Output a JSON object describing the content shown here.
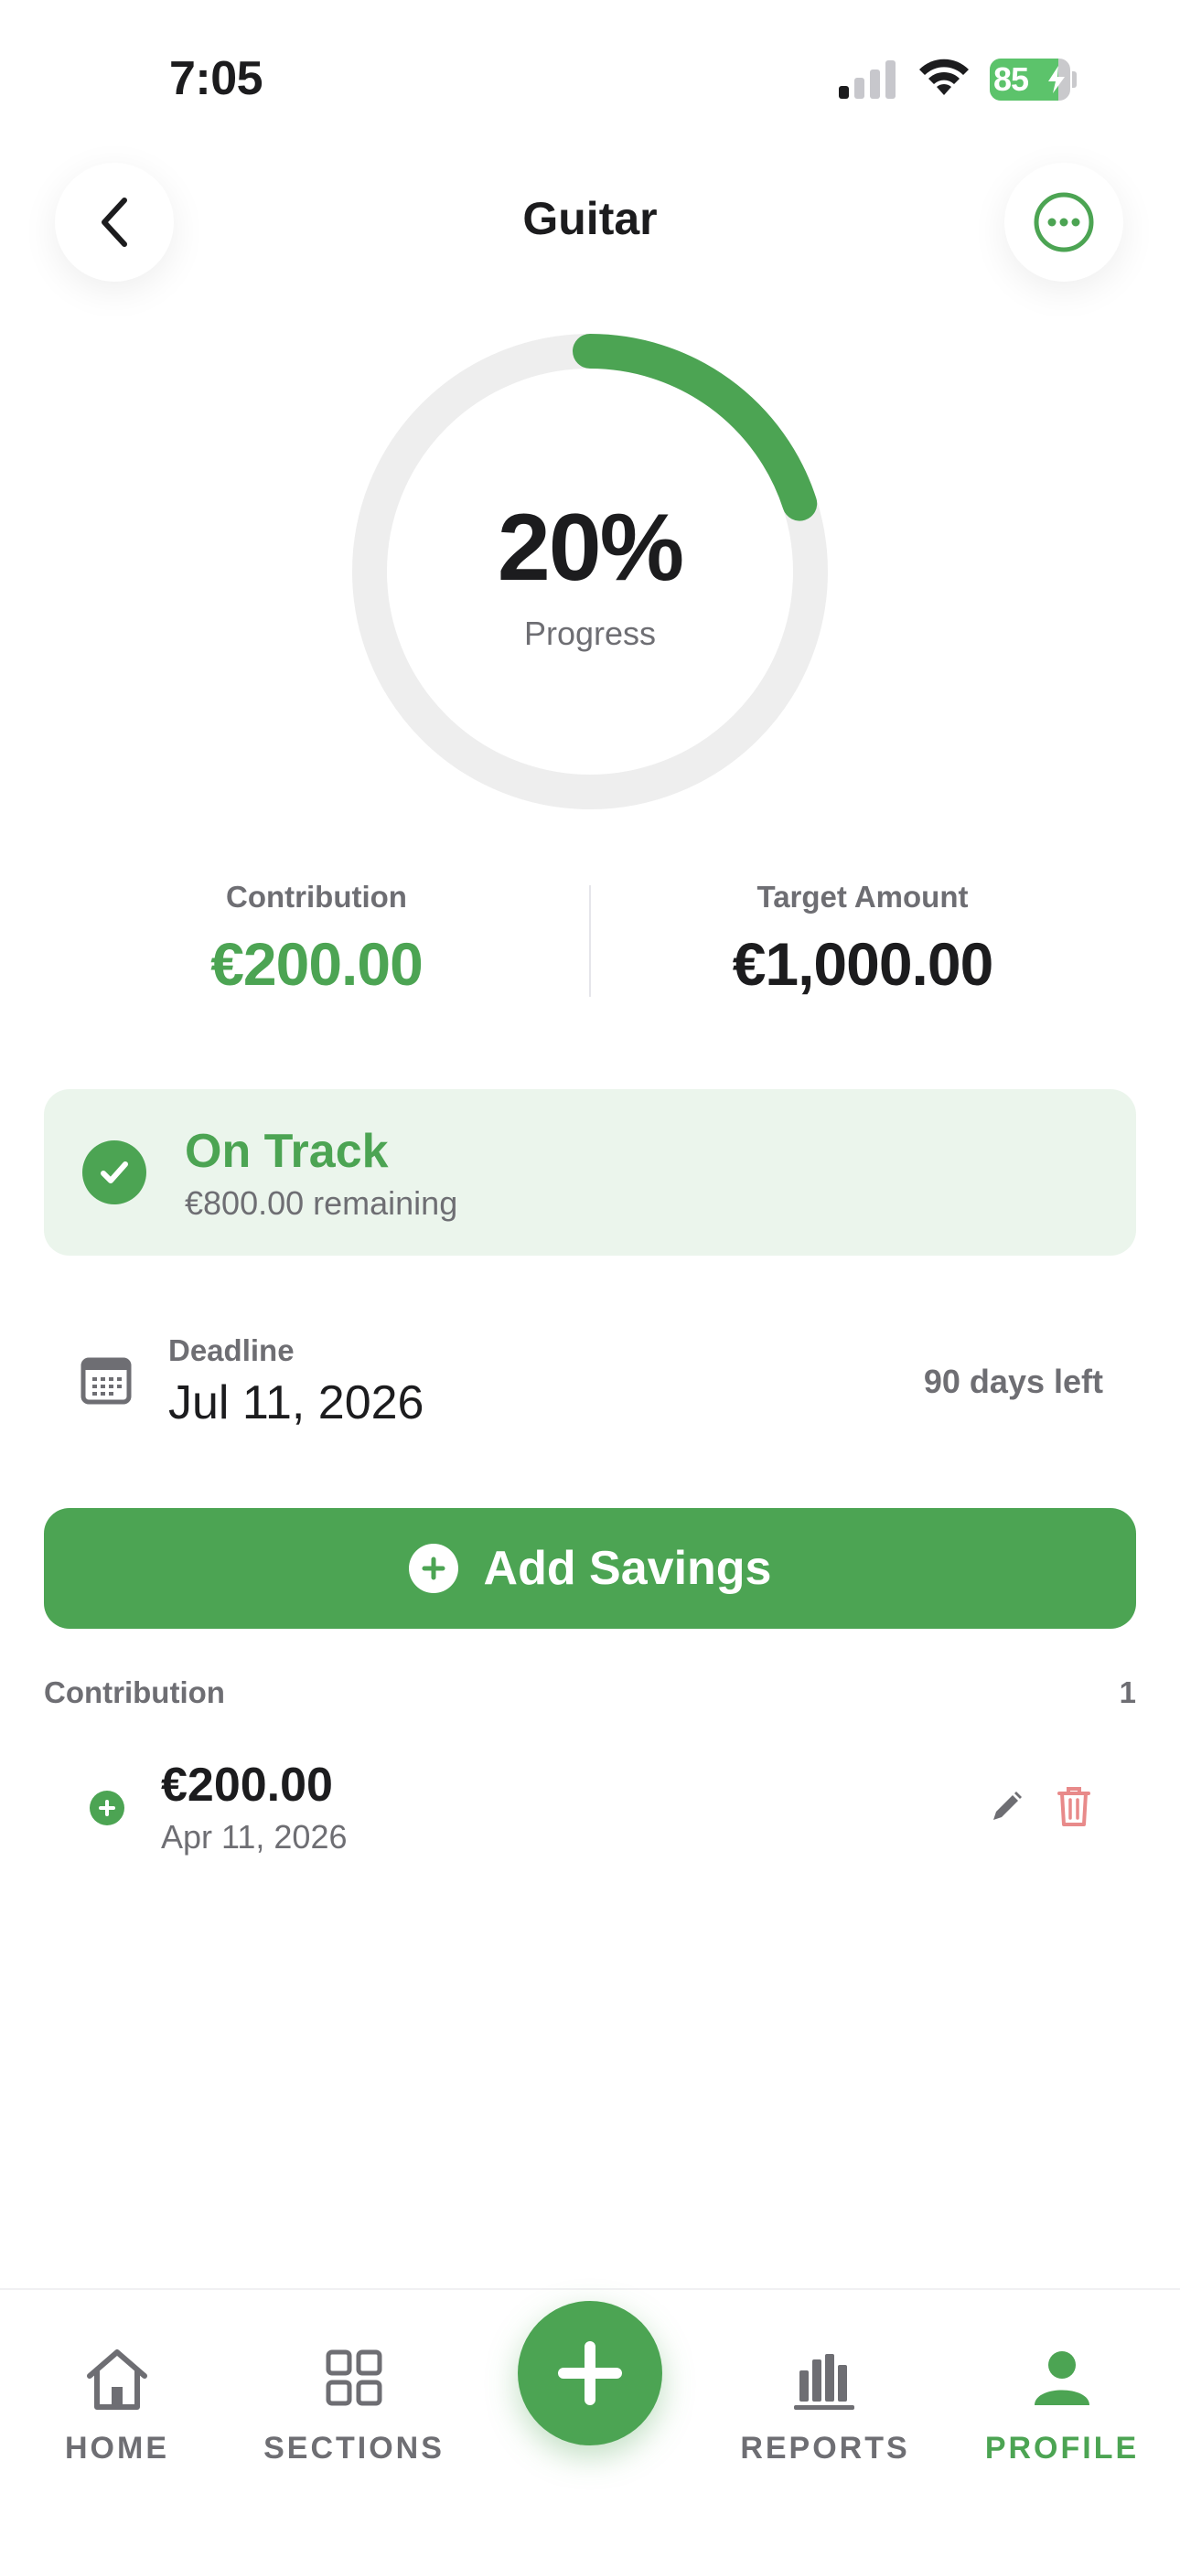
{
  "status_bar": {
    "time": "7:05",
    "battery_level": 85,
    "battery_text": "85",
    "icons": [
      "signal-icon",
      "wifi-icon",
      "battery-charging-icon"
    ]
  },
  "header": {
    "title": "Guitar",
    "back_icon": "chevron-left-icon",
    "more_icon": "more-horizontal-icon"
  },
  "progress": {
    "percent_text": "20%",
    "fraction": 0.2,
    "label": "Progress"
  },
  "stats": {
    "contribution_label": "Contribution",
    "contribution_value": "€200.00",
    "target_label": "Target Amount",
    "target_value": "€1,000.00"
  },
  "status_card": {
    "title": "On Track",
    "subtitle": "€800.00 remaining",
    "icon": "check-circle-icon"
  },
  "deadline": {
    "label": "Deadline",
    "date": "Jul 11, 2026",
    "days_left": "90 days left",
    "icon": "calendar-icon"
  },
  "add_button": {
    "label": "Add Savings",
    "icon": "plus-circle-icon"
  },
  "contributions": {
    "header": "Contribution",
    "count": "1",
    "items": [
      {
        "amount": "€200.00",
        "date": "Apr 11, 2026"
      }
    ]
  },
  "tabbar": {
    "tabs": [
      {
        "label": "HOME",
        "icon": "home-icon",
        "active": false
      },
      {
        "label": "SECTIONS",
        "icon": "grid-icon",
        "active": false
      },
      {
        "label": "REPORTS",
        "icon": "bar-chart-icon",
        "active": false
      },
      {
        "label": "PROFILE",
        "icon": "user-icon",
        "active": true
      }
    ],
    "fab_icon": "plus-icon"
  },
  "colors": {
    "accent": "#4ca453",
    "accent_light": "#ebf5ec",
    "text_primary": "#1c1c1e",
    "text_secondary": "#6e6e73",
    "ring_track": "#eeeeee",
    "danger": "#e88a8a"
  }
}
